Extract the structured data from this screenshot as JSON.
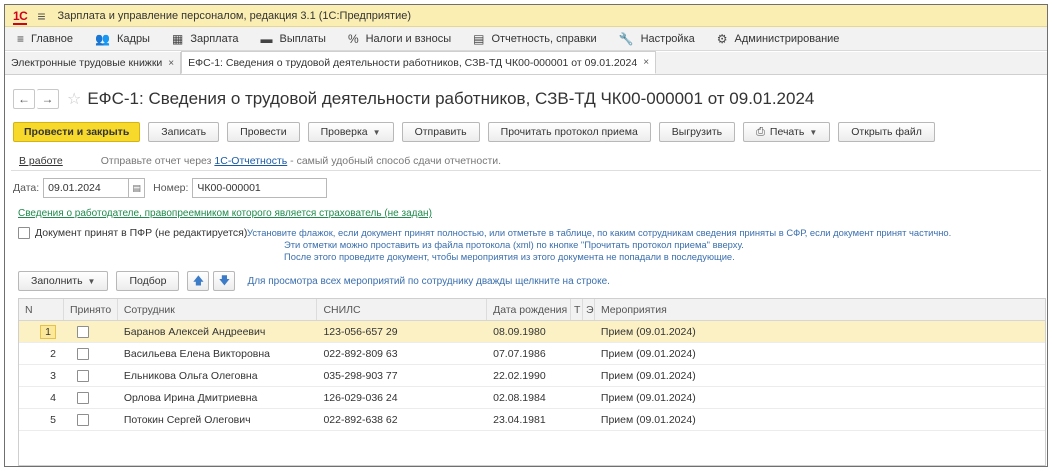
{
  "titlebar": {
    "logo": "1С",
    "title": "Зарплата и управление персоналом, редакция 3.1  (1С:Предприятие)"
  },
  "menu": [
    {
      "icon": "≡",
      "label": "Главное"
    },
    {
      "icon": "👥",
      "label": "Кадры"
    },
    {
      "icon": "▦",
      "label": "Зарплата"
    },
    {
      "icon": "▬",
      "label": "Выплаты"
    },
    {
      "icon": "%",
      "label": "Налоги и взносы"
    },
    {
      "icon": "▤",
      "label": "Отчетность, справки"
    },
    {
      "icon": "🔧",
      "label": "Настройка"
    },
    {
      "icon": "⚙",
      "label": "Администрирование"
    }
  ],
  "tabs": [
    {
      "label": "Электронные трудовые книжки",
      "close": "×"
    },
    {
      "label": "ЕФС-1: Сведения о трудовой деятельности работников, СЗВ-ТД ЧК00-000001 от 09.01.2024",
      "close": "×"
    }
  ],
  "form": {
    "back": "←",
    "forward": "→",
    "star": "☆",
    "title": "ЕФС-1: Сведения о трудовой деятельности работников, СЗВ-ТД ЧК00-000001 от 09.01.2024"
  },
  "toolbar": {
    "post_close": "Провести и закрыть",
    "save": "Записать",
    "post": "Провести",
    "check": "Проверка",
    "send": "Отправить",
    "read_protocol": "Прочитать протокол приема",
    "upload": "Выгрузить",
    "print": "Печать",
    "open_file": "Открыть файл"
  },
  "status": {
    "state": "В работе",
    "msg_prefix": "Отправьте отчет через ",
    "msg_link": "1С-Отчетность",
    "msg_suffix": " - самый удобный способ сдачи отчетности."
  },
  "fields": {
    "date_label": "Дата:",
    "date_value": "09.01.2024",
    "number_label": "Номер:",
    "number_value": "ЧК00-000001"
  },
  "employer_link": "Сведения о работодателе, правопреемником которого является страхователь (не задан)",
  "accepted": {
    "label": "Документ принят в ПФР (не редактируется)",
    "checked": false,
    "hint_lines": [
      "Установите флажок, если документ принят полностью, или отметьте в таблице, по каким сотрудникам сведения приняты в СФР, если документ принят частично.",
      "Эти отметки можно проставить из файла протокола (xml) по кнопке \"Прочитать протокол приема\" вверху.",
      "После этого проведите документ, чтобы мероприятия из этого документа не попадали в последующие."
    ]
  },
  "table_toolbar": {
    "fill": "Заполнить",
    "select": "Подбор",
    "up": "🡅",
    "down": "🡇",
    "hint": "Для просмотра всех мероприятий по сотруднику дважды щелкните на строке."
  },
  "table": {
    "columns": [
      "N",
      "Принято",
      "Сотрудник",
      "СНИЛС",
      "Дата рождения",
      "Т",
      "Э",
      "Мероприятия"
    ],
    "rows": [
      {
        "n": "1",
        "accepted": false,
        "employee": "Баранов Алексей Андреевич",
        "snils": "123-056-657 29",
        "dob": "08.09.1980",
        "events": "Прием (09.01.2024)",
        "selected": true
      },
      {
        "n": "2",
        "accepted": false,
        "employee": "Васильева Елена Викторовна",
        "snils": "022-892-809 63",
        "dob": "07.07.1986",
        "events": "Прием (09.01.2024)",
        "selected": false
      },
      {
        "n": "3",
        "accepted": false,
        "employee": "Ельникова Ольга Олеговна",
        "snils": "035-298-903 77",
        "dob": "22.02.1990",
        "events": "Прием (09.01.2024)",
        "selected": false
      },
      {
        "n": "4",
        "accepted": false,
        "employee": "Орлова Ирина Дмитриевна",
        "snils": "126-029-036 24",
        "dob": "02.08.1984",
        "events": "Прием (09.01.2024)",
        "selected": false
      },
      {
        "n": "5",
        "accepted": false,
        "employee": "Потокин Сергей Олегович",
        "snils": "022-892-638 62",
        "dob": "23.04.1981",
        "events": "Прием (09.01.2024)",
        "selected": false
      }
    ]
  },
  "colors": {
    "titlebar_bg": "#fbeeb2",
    "primary_button": "#f6d92a",
    "selected_row": "#fbf1c4",
    "link_green": "#1f8a4c",
    "hint_blue": "#3a6fae"
  }
}
